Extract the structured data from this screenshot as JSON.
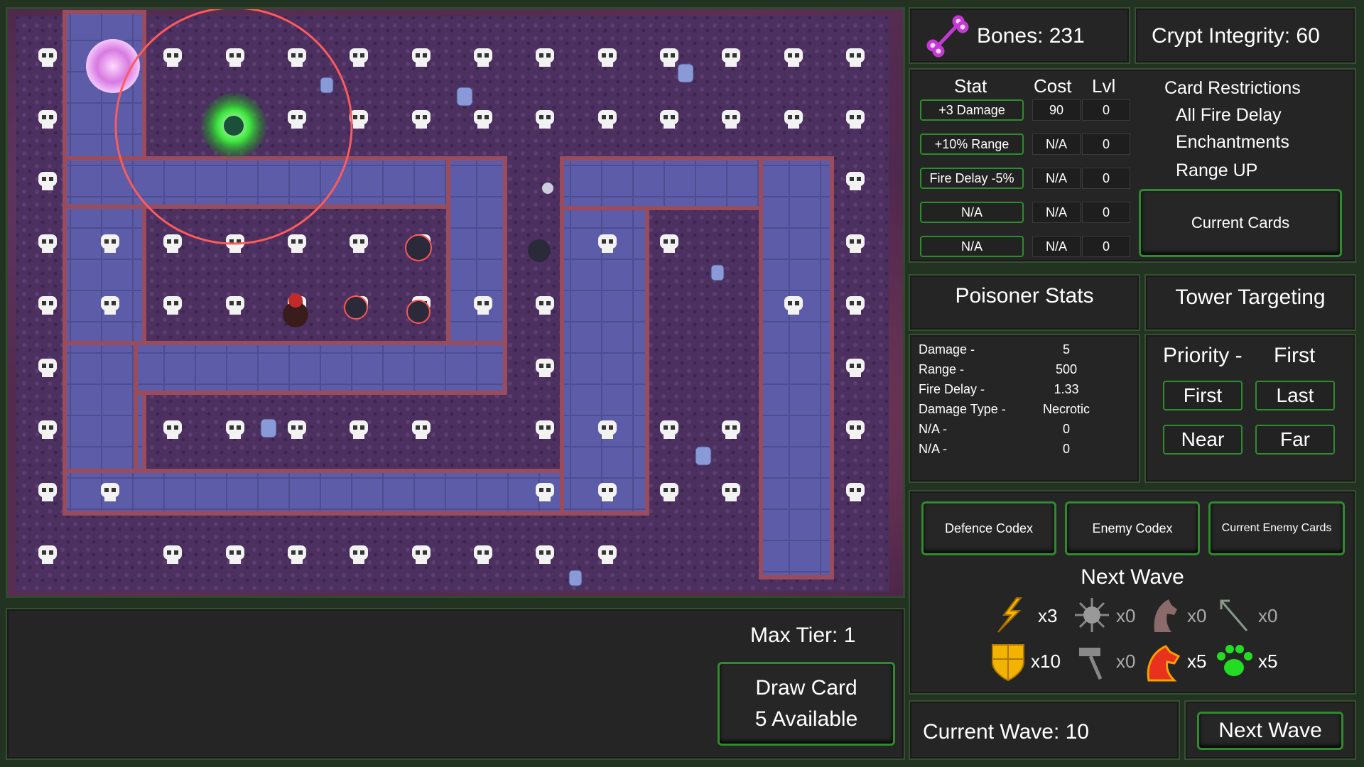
{
  "resources": {
    "bones_label": "Bones: 231",
    "crypt_label": "Crypt Integrity: 60"
  },
  "upgrades": {
    "headers": {
      "stat": "Stat",
      "cost": "Cost",
      "lvl": "Lvl"
    },
    "rows": [
      {
        "stat": "+3 Damage",
        "cost": "90",
        "lvl": "0"
      },
      {
        "stat": "+10% Range",
        "cost": "N/A",
        "lvl": "0"
      },
      {
        "stat": "Fire Delay -5%",
        "cost": "N/A",
        "lvl": "0"
      },
      {
        "stat": "N/A",
        "cost": "N/A",
        "lvl": "0"
      },
      {
        "stat": "N/A",
        "cost": "N/A",
        "lvl": "0"
      }
    ]
  },
  "restrictions": {
    "title": "Card Restrictions",
    "items": [
      "All Fire Delay",
      "Enchantments",
      "Range UP"
    ],
    "current_cards": "Current Cards"
  },
  "tower": {
    "stats_title": "Poisoner Stats",
    "stats": [
      {
        "label": "Damage -",
        "value": "5"
      },
      {
        "label": "Range -",
        "value": "500"
      },
      {
        "label": "Fire Delay -",
        "value": "1.33"
      },
      {
        "label": "Damage Type -",
        "value": "Necrotic"
      },
      {
        "label": "N/A -",
        "value": "0"
      },
      {
        "label": "N/A -",
        "value": "0"
      }
    ]
  },
  "targeting": {
    "title": "Tower Targeting",
    "priority_label": "Priority -",
    "priority_value": "First",
    "options": [
      "First",
      "Last",
      "Near",
      "Far"
    ]
  },
  "codex": {
    "defence": "Defence Codex",
    "enemy": "Enemy Codex",
    "current_enemy": "Current Enemy Cards"
  },
  "next_wave": {
    "title": "Next Wave",
    "enemies": [
      {
        "icon": "lightning-spear-icon",
        "count": "x3"
      },
      {
        "icon": "spiky-sun-icon",
        "count": "x0"
      },
      {
        "icon": "horse-head-icon",
        "count": "x0"
      },
      {
        "icon": "arrow-icon",
        "count": "x0"
      },
      {
        "icon": "shield-icon",
        "count": "x10"
      },
      {
        "icon": "hammer-icon",
        "count": "x0"
      },
      {
        "icon": "fire-horse-icon",
        "count": "x5"
      },
      {
        "icon": "paw-print-icon",
        "count": "x5"
      }
    ]
  },
  "wave": {
    "current": "Current Wave: 10",
    "next_button": "Next Wave"
  },
  "cards": {
    "max_tier": "Max Tier: 1",
    "draw_line1": "Draw Card",
    "draw_line2": "5  Available"
  },
  "colors": {
    "accent_green": "#2e8b2e",
    "path_blue": "#5a5aa0",
    "ground_purple": "#4a2647",
    "skull_white": "#f2f2f2",
    "range_ring": "#ff5a5a"
  }
}
